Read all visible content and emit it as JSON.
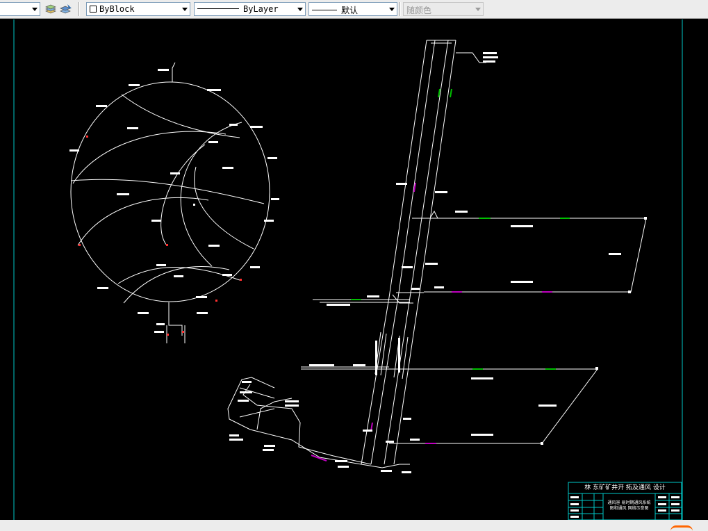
{
  "toolbar": {
    "layer_value": "",
    "color_value": "ByBlock",
    "linetype_value": "ByLayer",
    "lineweight_value": "默认",
    "plotstyle_value": "随颜色",
    "icons": [
      "layer-previous-icon",
      "layer-manager-icon"
    ]
  },
  "title_block": {
    "title": "林 东矿矿井开 拓及通风 设计",
    "subtitle_line1": "通风容 易时期通风系统",
    "subtitle_line2": "图和通风 网络示意图"
  },
  "colors": {
    "canvas": "#000000",
    "entity": "#ffffff",
    "accent_green": "#00c000",
    "accent_magenta": "#c000c0",
    "border_cyan": "#00c8c8",
    "label_red": "#ff3030"
  }
}
